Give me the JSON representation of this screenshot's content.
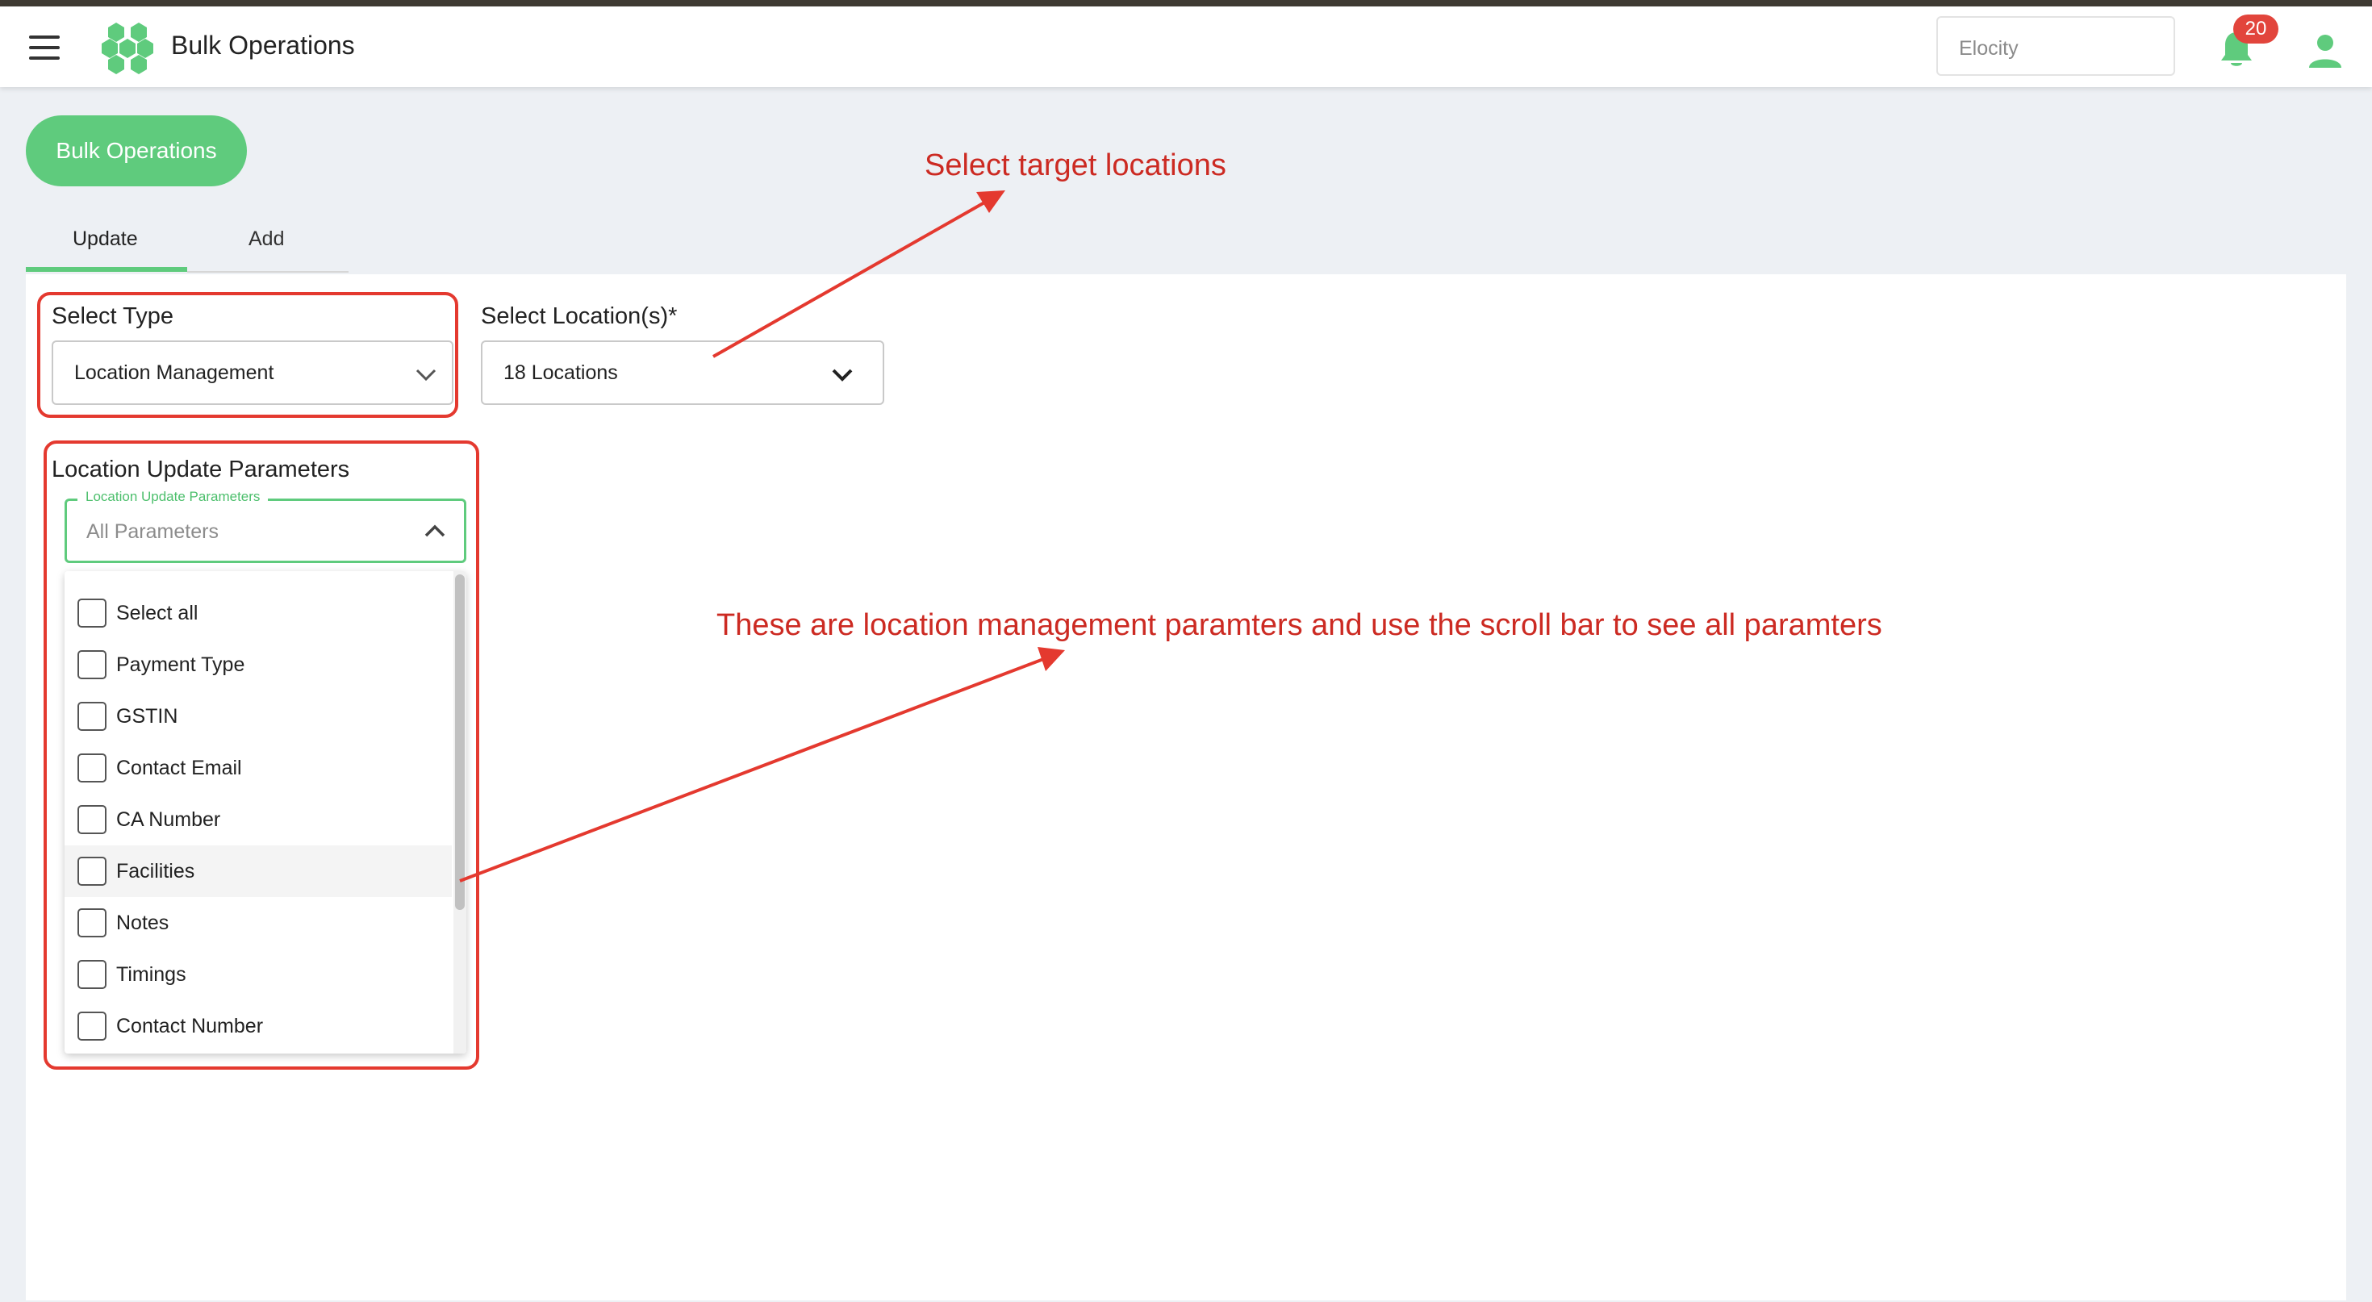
{
  "app": {
    "title": "Bulk Operations"
  },
  "header": {
    "org_name": "Elocity",
    "notification_count": "20"
  },
  "page": {
    "action_button": "Bulk Operations"
  },
  "tabs": [
    {
      "label": "Update",
      "active": true
    },
    {
      "label": "Add",
      "active": false
    }
  ],
  "form": {
    "select_type": {
      "label": "Select Type",
      "value": "Location Management"
    },
    "select_locations": {
      "label": "Select Location(s)*",
      "value": "18 Locations"
    },
    "params": {
      "section_label": "Location Update Parameters",
      "field_legend": "Location Update Parameters",
      "placeholder": "All Parameters",
      "options": [
        "Select all",
        "Payment Type",
        "GSTIN",
        "Contact Email",
        "CA Number",
        "Facilities",
        "Notes",
        "Timings",
        "Contact Number"
      ],
      "hovered_option": "Facilities"
    }
  },
  "annotations": {
    "locations_note": "Select target locations",
    "params_note": "These are location management paramters and use the scroll bar to see all paramters"
  },
  "colors": {
    "brand_green": "#5fcb7d",
    "annotation_red": "#e4392f",
    "badge_red": "#e2453c"
  },
  "icons": [
    "menu-icon",
    "logo-icon",
    "bell-icon",
    "user-icon",
    "chevron-down-icon",
    "chevron-up-icon",
    "checkbox-icon"
  ]
}
